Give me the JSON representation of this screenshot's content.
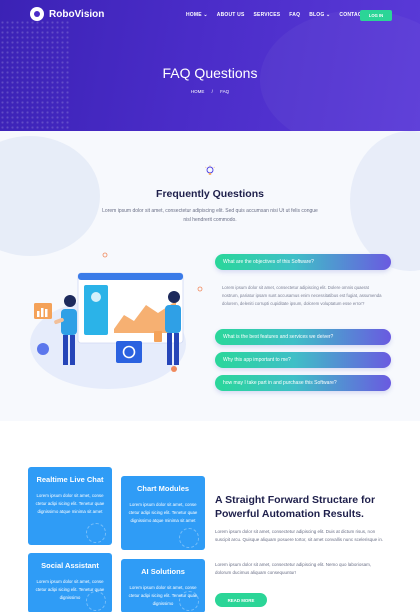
{
  "header": {
    "logo_text": "RoboVision",
    "nav": [
      "HOME ⌄",
      "ABOUT US",
      "SERVICES",
      "FAQ",
      "BLOG ⌄",
      "CONTACT"
    ],
    "login_label": "LOG IN"
  },
  "hero": {
    "title": "FAQ Questions",
    "breadcrumb": [
      "HOME",
      "/",
      "FAQ"
    ]
  },
  "faq": {
    "title": "Frequently Questions",
    "subtitle": "Lorem ipsum dolor sit amet, consectetur adipiscing elit. Sed quis accumsan nisi Ut ut felis congue nisl hendrerit commodo.",
    "items": [
      "What are the objectives of this Software?",
      "What is the best features and services we deiver?",
      "Why this app important to me?",
      "how may I take part in and purchase this Software?"
    ],
    "open_answer": "Lorem ipsum dolor sit amet, consectetur adipiscing elit. Dolere omnis quaerat nostrum, pariatur ipsam sunt accusamus enim necessitatibus est fugiat, assumenda dolorem, deleniti corrupti cupiditate ipsum, dolorem voluptatum esse error?"
  },
  "services": {
    "cards": [
      {
        "title": "Realtime Live Chat",
        "body": "Lorem ipsum dolor sit amet, conse ctetur adipi sicing elit. Tenetur quae dignissimo atque minima sit amet"
      },
      {
        "title": "Chart Modules",
        "body": "Lorem ipsum dolor sit amet, conse ctetur adipi sicing elit. Tenetur quae dignissimo atque minima sit amet"
      },
      {
        "title": "Social Assistant",
        "body": "Lorem ipsum dolor sit amet, conse ctetur adipi sicing elit. Tenetur quae dignissimo"
      },
      {
        "title": "AI Solutions",
        "body": "Lorem ipsum dolor sit amet, conse ctetur adipi sicing elit. Tenetur quae dignissimo"
      }
    ],
    "heading": "A Straight Forward Structare for Powerful Automation Results.",
    "para1": "Lorem ipsum dolor sit amet, consectetur adipiscing elit. Duis at dictum risus, non suscipit arcu. Quisque aliquam posuere tortor, sit amet convallis nunc scelerisque in.",
    "para2": "Lorem ipsum dolor sit amet, consectetur adipiscing elit. Nemo quo laboriosam, dolorum ducimus aliquam consequuntur!",
    "button": "READ MORE"
  },
  "colors": {
    "hero_start": "#3b22b5",
    "hero_end": "#5a3ad8",
    "accent_green": "#2bd597",
    "card_blue": "#2f9cf6",
    "heading_navy": "#1e1f4b"
  }
}
